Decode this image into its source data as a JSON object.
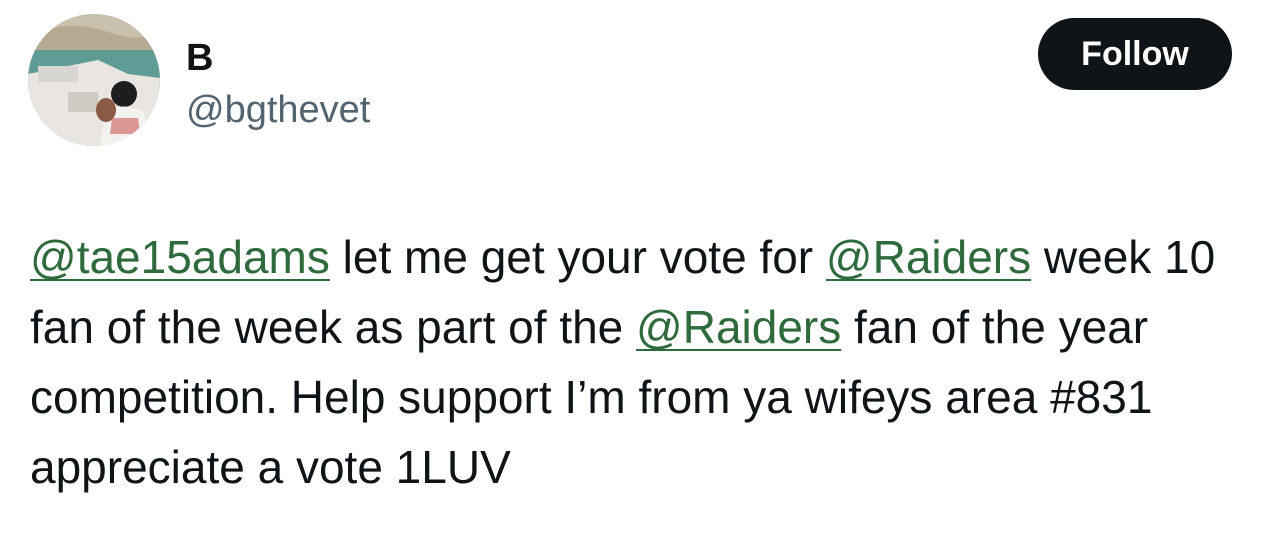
{
  "author": {
    "display_name": "B",
    "handle": "@bgthevet"
  },
  "follow_button": {
    "label": "Follow"
  },
  "tweet": {
    "segments": [
      {
        "type": "mention",
        "text": "@tae15adams"
      },
      {
        "type": "text",
        "text": " let me get your vote for "
      },
      {
        "type": "mention",
        "text": "@Raiders"
      },
      {
        "type": "text",
        "text": " week 10 fan of the week as part of the "
      },
      {
        "type": "mention",
        "text": "@Raiders"
      },
      {
        "type": "text",
        "text": " fan of the year competition. Help support I’m from ya wifeys area #831 appreciate a vote 1LUV"
      }
    ]
  },
  "colors": {
    "mention": "#2f6a3d",
    "follow_bg": "#0f1419",
    "handle": "#536471"
  }
}
